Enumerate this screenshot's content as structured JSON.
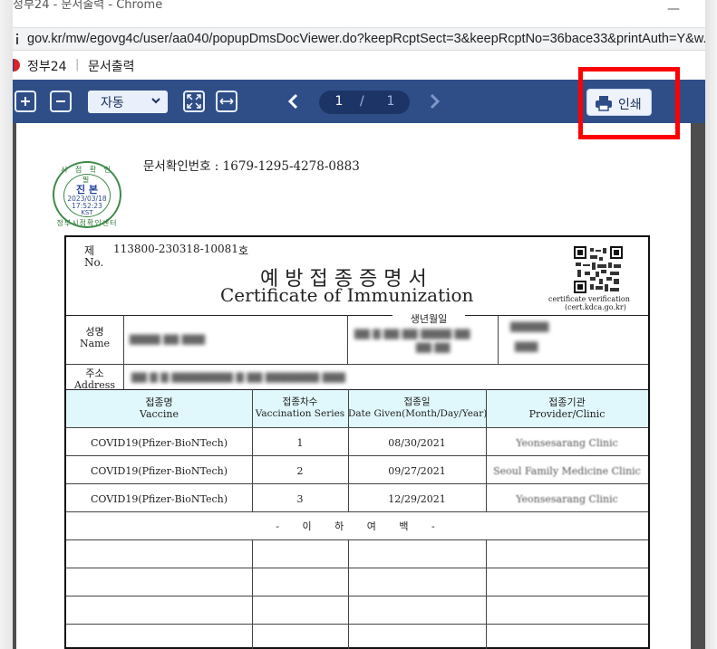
{
  "window": {
    "title": "정부24 - 문서출력 - Chrome",
    "url": "gov.kr/mw/egovg4c/user/aa040/popupDmsDocViewer.do?keepRcptSect=3&keepRcptNo=36bace33&printAuth=Y&w..."
  },
  "site": {
    "brand": "정부24",
    "page_name": "문서출력"
  },
  "toolbar": {
    "zoom_value": "자동",
    "current_page": "1",
    "page_separator": "/",
    "total_pages": "1",
    "print_label": "인쇄",
    "icons": [
      "zoom-in-icon",
      "zoom-out-icon",
      "chevron-down-icon",
      "fit-page-icon",
      "fit-width-icon",
      "prev-page-icon",
      "next-page-icon",
      "printer-icon"
    ]
  },
  "highlight_color": "#ff0000",
  "toolbar_color": "#2f4e88",
  "document": {
    "seal": {
      "top_text": "시 점 확 인 필",
      "main_text": "진 본",
      "date": "2023/03/18",
      "time": "17:52:23",
      "zone": "KST",
      "bottom_text": "정부시점확인센터"
    },
    "doc_number_label": "문서확인번호 :",
    "doc_number": "1679-1295-4278-0883",
    "cert": {
      "no_label_ko": "제",
      "no_label_en": "No.",
      "serial": "113800-230318-10081",
      "ho": "호",
      "title_ko": "예방접종증명서",
      "title_en": "Certificate of Immunization",
      "verify_line1": "certificate verification",
      "verify_line2": "(cert.kdca.go.kr)",
      "name_label_ko": "성명",
      "name_label_en": "Name",
      "birth_label_ko": "생년월일",
      "address_label_ko": "주소",
      "address_label_en": "Address",
      "table_headers": [
        {
          "ko": "접종명",
          "en": "Vaccine"
        },
        {
          "ko": "접종차수",
          "en": "Vaccination Series"
        },
        {
          "ko": "접종일",
          "en": "Date Given(Month/Day/Year)"
        },
        {
          "ko": "접종기관",
          "en": "Provider/Clinic"
        }
      ],
      "rows": [
        {
          "vaccine": "COVID19(Pfizer-BioNTech)",
          "series": "1",
          "date": "08/30/2021",
          "provider": "Yeonsesarang Clinic"
        },
        {
          "vaccine": "COVID19(Pfizer-BioNTech)",
          "series": "2",
          "date": "09/27/2021",
          "provider": "Seoul Family Medicine Clinic"
        },
        {
          "vaccine": "COVID19(Pfizer-BioNTech)",
          "series": "3",
          "date": "12/29/2021",
          "provider": "Yeonsesarang Clinic"
        }
      ],
      "blank_text": "- 이 하 여 백 -"
    }
  }
}
